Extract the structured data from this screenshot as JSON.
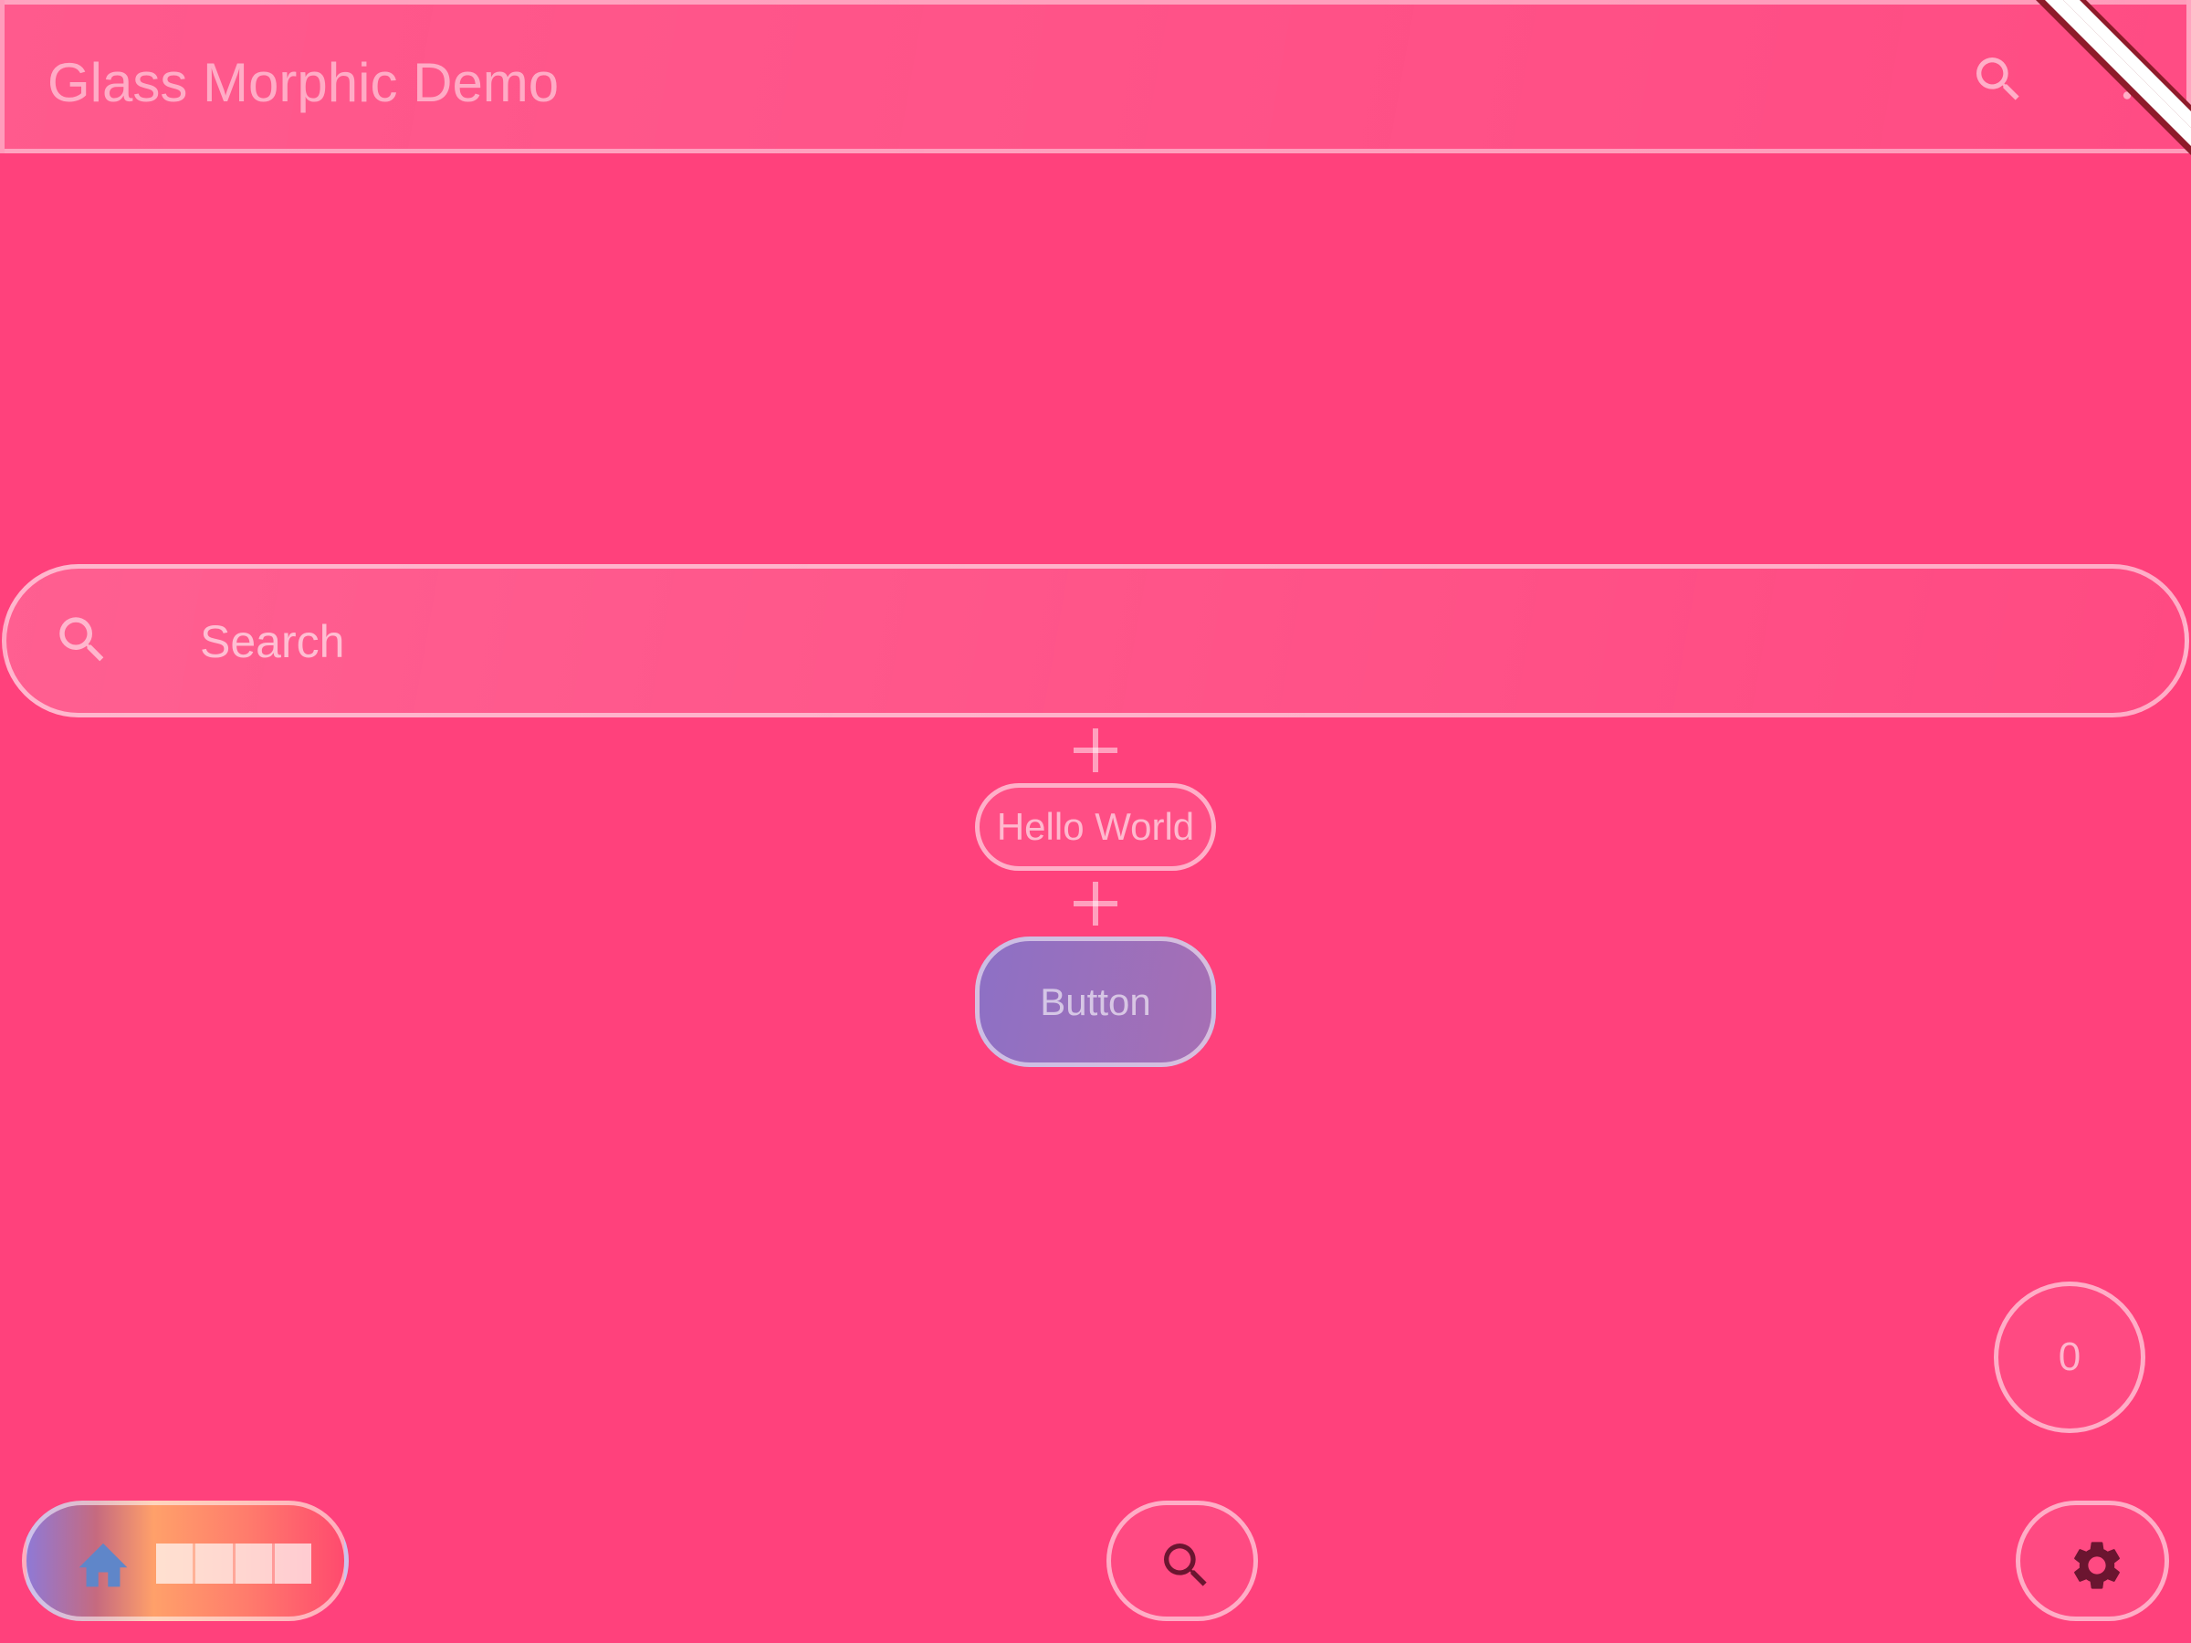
{
  "app_bar": {
    "title": "Glass Morphic Demo",
    "actions": [
      {
        "icon": "search-icon"
      },
      {
        "icon": "more-vert-icon"
      }
    ]
  },
  "search": {
    "placeholder": "Search",
    "icon": "search-icon"
  },
  "chip": {
    "label": "Hello World"
  },
  "primary_button": {
    "label": "Button"
  },
  "counter": {
    "value": "0"
  },
  "bottom_nav": {
    "items": [
      {
        "icon": "home-icon",
        "selected": true
      },
      {
        "icon": "search-icon",
        "selected": false
      },
      {
        "icon": "settings-icon",
        "selected": false
      }
    ]
  },
  "colors": {
    "background": "#ff417c",
    "glass_border": "#ffffff",
    "button_gradient_start": "#8d70c5",
    "button_gradient_end": "#a66fb4",
    "icon_dark": "#6b1530",
    "home_icon": "#5f86c9",
    "debug_banner": "#8e1b2a"
  }
}
